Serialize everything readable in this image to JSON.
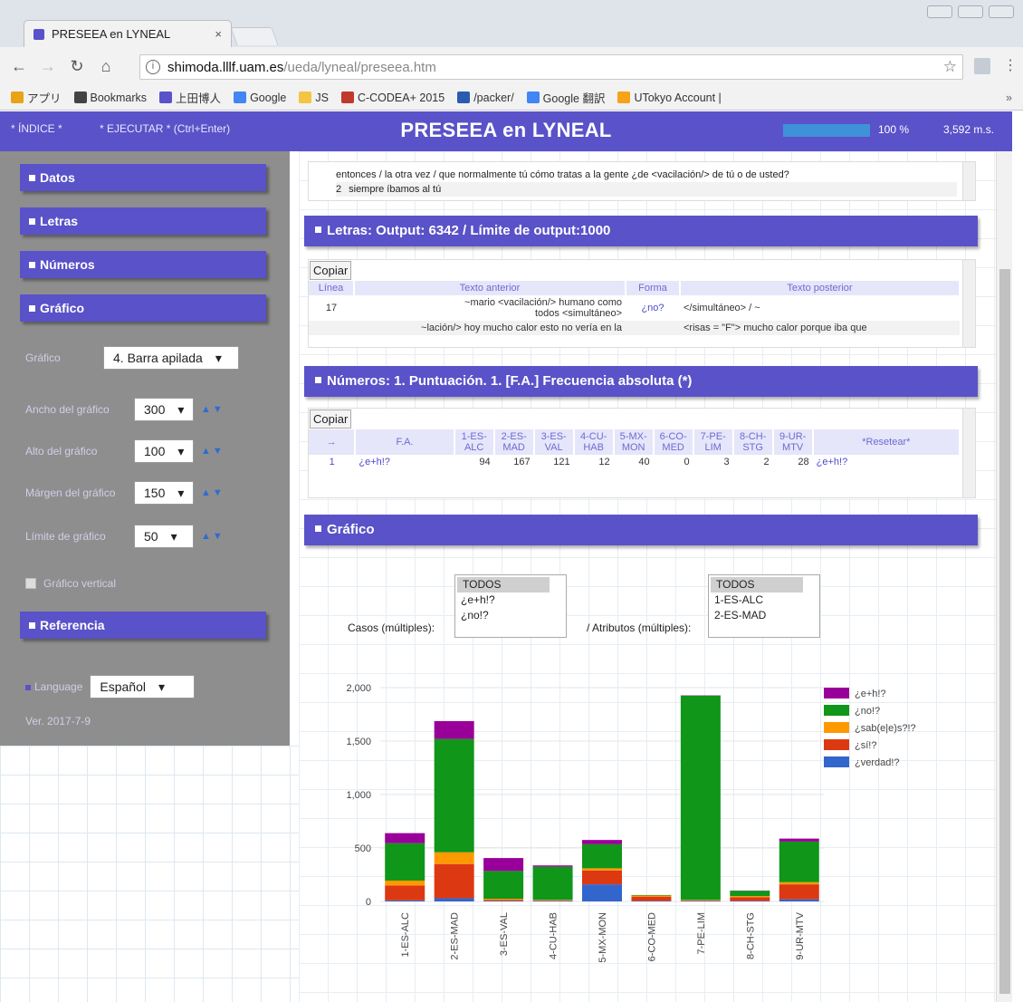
{
  "browser": {
    "tab_title": "PRESEEA en LYNEAL",
    "tab_close": "×",
    "url_host": "shimoda.lllf.uam.es",
    "url_path": "/ueda/lyneal/preseea.htm",
    "bookmarks": [
      {
        "label": "アプリ",
        "icon": "apps-icon",
        "color": "#e8a317"
      },
      {
        "label": "Bookmarks",
        "icon": "star-icon",
        "color": "#444444"
      },
      {
        "label": "上田博人",
        "icon": "site-icon",
        "color": "#5a52c8"
      },
      {
        "label": "Google",
        "icon": "google-icon",
        "color": "#4285f4"
      },
      {
        "label": "JS",
        "icon": "folder-icon",
        "color": "#f4c542"
      },
      {
        "label": "C-CODEA+ 2015",
        "icon": "site-icon",
        "color": "#c0392b"
      },
      {
        "label": "/packer/",
        "icon": "site-icon",
        "color": "#2a5db0"
      },
      {
        "label": "Google 翻訳",
        "icon": "translate-icon",
        "color": "#4285f4"
      },
      {
        "label": "UTokyo Account |",
        "icon": "site-icon",
        "color": "#f4a31a"
      }
    ],
    "bookmarks_more": "»"
  },
  "header": {
    "indice": "* ÍNDICE *",
    "ejecutar": "* EJECUTAR * (Ctrl+Enter)",
    "title": "PRESEEA en LYNEAL",
    "progress": 1.0,
    "progress_text": "100 %",
    "time_text": "3,592 m.s."
  },
  "sidebar": {
    "sections": [
      "Datos",
      "Letras",
      "Números",
      "Gráfico"
    ],
    "grafico_label": "Gráfico",
    "grafico_value": "4. Barra apilada",
    "ancho_label": "Ancho del gráfico",
    "ancho_value": "300",
    "alto_label": "Alto del gráfico",
    "alto_value": "100",
    "margen_label": "Márgen del gráfico",
    "margen_value": "150",
    "limite_label": "Límite de gráfico",
    "limite_value": "50",
    "vertical_label": "Gráfico vertical",
    "referencia": "Referencia",
    "language_label": "Language",
    "language_value": "Español",
    "version": "Ver. 2017-7-9"
  },
  "top_text": {
    "line1": "entonces / la otra vez / que normalmente tú cómo tratas a la gente ¿de <vacilación/> de tú o de usted?",
    "line2_num": "2",
    "line2": "siempre íbamos al tú"
  },
  "letras": {
    "title": "Letras: Output: 6342 / Límite de output:1000",
    "copy": "Copiar",
    "headers": [
      "Línea",
      "Texto anterior",
      "Forma",
      "Texto posterior"
    ],
    "row_line": "17",
    "row_before": "~mario <vacilación/> humano como todos <simultáneo>",
    "row_form": "¿no?",
    "row_after": "</simultáneo> / ~",
    "row2_before": "~lación/> hoy mucho calor esto no vería en la",
    "row2_after": "<risas = \"F\"> mucho calor porque iba que"
  },
  "numeros": {
    "title": "Números: 1. Puntuación. 1. [F.A.] Frecuencia absoluta (*)",
    "copy": "Copiar",
    "headers": [
      "→",
      "F.A.",
      "1-ES-ALC",
      "2-ES-MAD",
      "3-ES-VAL",
      "4-CU-HAB",
      "5-MX-MON",
      "6-CO-MED",
      "7-PE-LIM",
      "8-CH-STG",
      "9-UR-MTV",
      "*Resetear*"
    ],
    "row": [
      "1",
      "¿e+h!?",
      "94",
      "167",
      "121",
      "12",
      "40",
      "0",
      "3",
      "2",
      "28",
      "¿e+h!?"
    ]
  },
  "grafico": {
    "title": "Gráfico",
    "casos_label": "Casos (múltiples):",
    "casos_options": [
      "TODOS",
      "¿e+h!?",
      "¿no!?"
    ],
    "atributos_label": "/ Atributos (múltiples):",
    "atributos_options": [
      "TODOS",
      "1-ES-ALC",
      "2-ES-MAD"
    ]
  },
  "chart_data": {
    "type": "bar",
    "stacked": true,
    "categories": [
      "1-ES-ALC",
      "2-ES-MAD",
      "3-ES-VAL",
      "4-CU-HAB",
      "5-MX-MON",
      "6-CO-MED",
      "7-PE-LIM",
      "8-CH-STG",
      "9-UR-MTV"
    ],
    "series": [
      {
        "name": "¿verdad!?",
        "color": "#3366cc",
        "values": [
          10,
          30,
          5,
          5,
          160,
          5,
          5,
          5,
          20
        ]
      },
      {
        "name": "¿sí!?",
        "color": "#dc3912",
        "values": [
          140,
          320,
          10,
          5,
          130,
          40,
          5,
          35,
          140
        ]
      },
      {
        "name": "¿sab(e|e)s?!?",
        "color": "#ff9900",
        "values": [
          45,
          110,
          10,
          5,
          20,
          10,
          5,
          10,
          20
        ]
      },
      {
        "name": "¿no!?",
        "color": "#109618",
        "values": [
          350,
          1060,
          260,
          310,
          225,
          5,
          1910,
          50,
          380
        ]
      },
      {
        "name": "¿e+h!?",
        "color": "#990099",
        "values": [
          94,
          167,
          121,
          12,
          40,
          0,
          3,
          2,
          28
        ]
      }
    ],
    "yticks": [
      "0",
      "500",
      "1,000",
      "1,500",
      "2,000"
    ],
    "ylim": [
      0,
      2000
    ],
    "legend": "right"
  }
}
